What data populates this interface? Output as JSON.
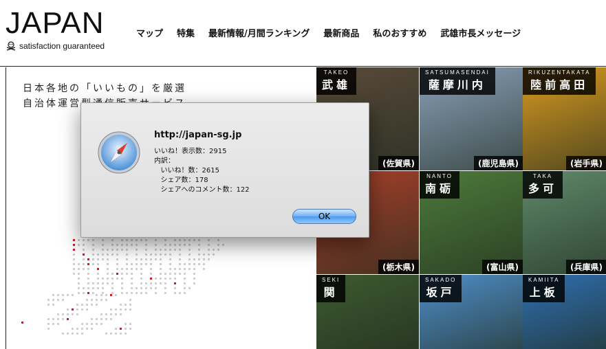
{
  "header": {
    "logo_word": "JAPAN",
    "logo_tagline": "satisfaction guaranteed",
    "nav": [
      "マップ",
      "特集",
      "最新情報/月間ランキング",
      "最新商品",
      "私のおすすめ",
      "武雄市長メッセージ"
    ]
  },
  "left": {
    "tagline_line1": "日本各地の「いいもの」を厳選",
    "tagline_line2": "自治体運営型通信販売サービス"
  },
  "tiles": [
    {
      "romaji": "TAKEO",
      "kanji": "武雄",
      "pref": "(佐賀県)",
      "color": "#5a4a3a"
    },
    {
      "romaji": "SATSUMASENDAI",
      "kanji": "薩摩川内",
      "pref": "(鹿児島県)",
      "color": "#8aa0b8"
    },
    {
      "romaji": "RIKUZENTAKATA",
      "kanji": "陸前高田",
      "pref": "(岩手県)",
      "color": "#d99a20"
    },
    {
      "romaji": "",
      "kanji": "",
      "pref": "(栃木県)",
      "color": "#a8402a"
    },
    {
      "romaji": "NANTO",
      "kanji": "南砺",
      "pref": "(富山県)",
      "color": "#4d7a3a"
    },
    {
      "romaji": "TAKA",
      "kanji": "多可",
      "pref": "(兵庫県)",
      "color": "#5f8a6a"
    },
    {
      "romaji": "SEKI",
      "kanji": "関",
      "pref": "",
      "color": "#3e5a30"
    },
    {
      "romaji": "SAKADO",
      "kanji": "坂戸",
      "pref": "",
      "color": "#4f8ec8"
    },
    {
      "romaji": "KAMIITA",
      "kanji": "上板",
      "pref": "",
      "color": "#2f6fb0"
    }
  ],
  "dialog": {
    "title": "http://japan-sg.jp",
    "lines": [
      "いいね！表示数：2915",
      "",
      "内訳：",
      "   いいね！数：2615",
      "   シェア数：178",
      "   シェアへのコメント数：122"
    ],
    "ok_label": "OK",
    "icon": "safari-compass-icon"
  }
}
